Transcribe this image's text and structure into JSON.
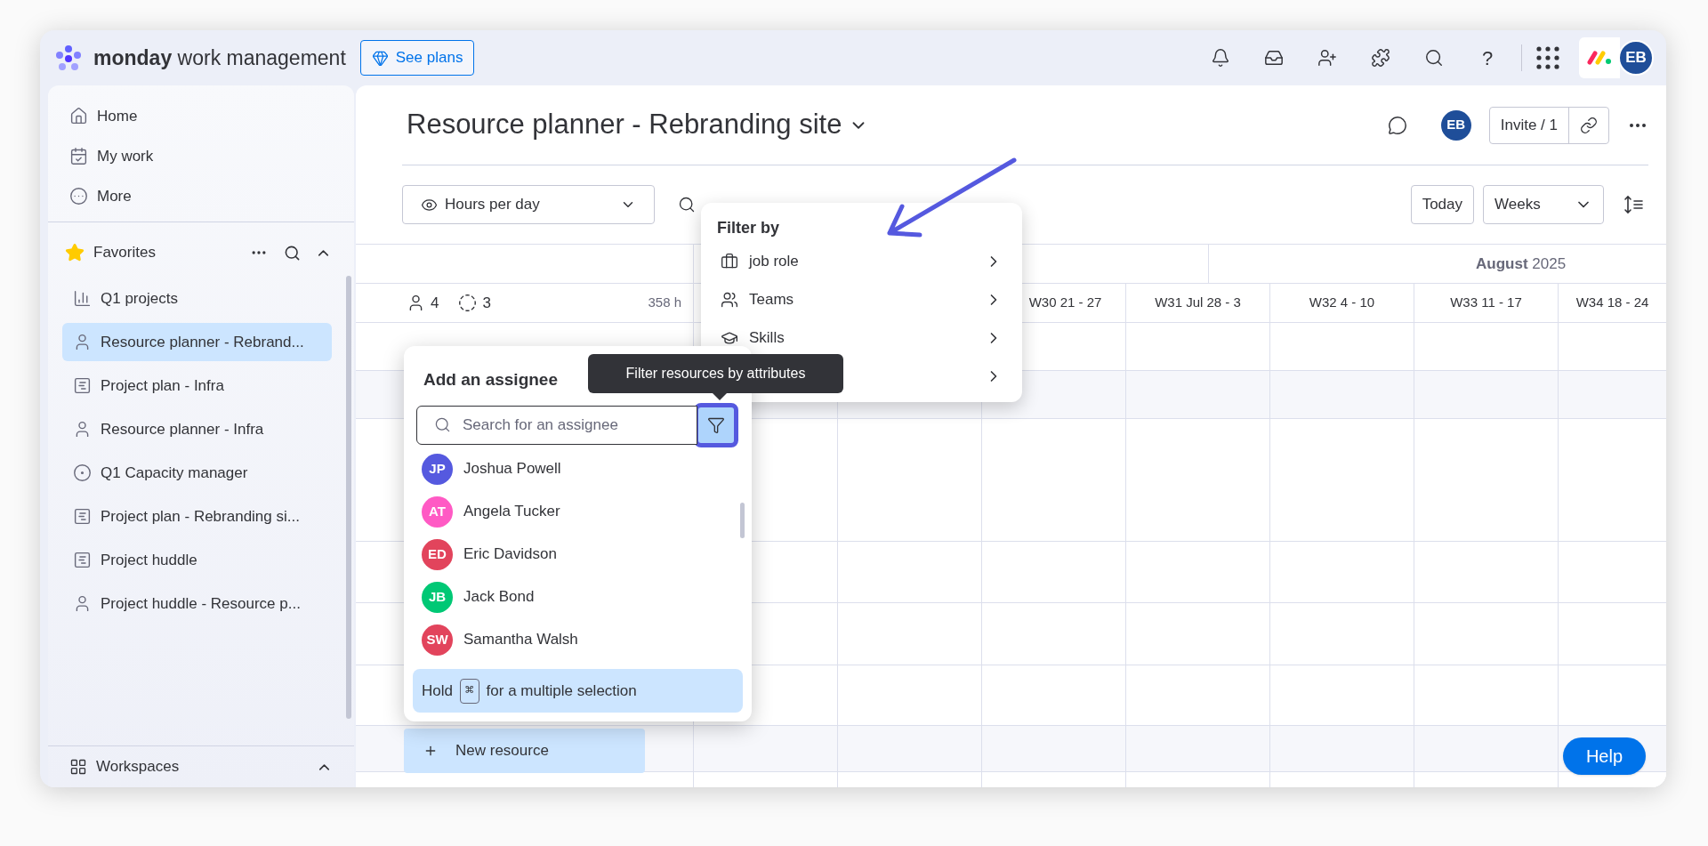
{
  "top_bar": {
    "brand_bold": "monday",
    "brand_rest": "work management",
    "plans_button": "See plans",
    "help_glyph": "?",
    "avatar": "EB"
  },
  "sidebar": {
    "nav": [
      {
        "label": "Home",
        "kind": "home"
      },
      {
        "label": "My work",
        "kind": "calendar"
      },
      {
        "label": "More",
        "kind": "more"
      }
    ],
    "favorites": {
      "title": "Favorites",
      "expanded": true,
      "items": [
        {
          "label": "Q1 projects",
          "kind": "chart",
          "selected": false
        },
        {
          "label": "Resource planner - Rebrand...",
          "kind": "person",
          "selected": true
        },
        {
          "label": "Project plan - Infra",
          "kind": "plan",
          "selected": false
        },
        {
          "label": "Resource planner - Infra",
          "kind": "person",
          "selected": false
        },
        {
          "label": "Q1 Capacity manager",
          "kind": "target",
          "selected": false
        },
        {
          "label": "Project plan - Rebranding si...",
          "kind": "plan",
          "selected": false
        },
        {
          "label": "Project huddle",
          "kind": "plan",
          "selected": false
        },
        {
          "label": "Project huddle - Resource p...",
          "kind": "person",
          "selected": false
        }
      ]
    },
    "workspaces": {
      "title": "Workspaces",
      "expanded": true
    }
  },
  "board": {
    "title": "Resource planner - Rebranding site",
    "avatar": "EB",
    "invite_button": "Invite / 1"
  },
  "toolbar": {
    "view_select": "Hours per day",
    "today_button": "Today",
    "scale_select": "Weeks"
  },
  "timeline": {
    "people_count": "4",
    "placeholder_count": "3",
    "total_hours": "358 h",
    "month": "**August** 2025",
    "weeks": [
      "W30 21 - 27",
      "W31 Jul 28 - 3",
      "W32 4 - 10",
      "W33 11 - 17",
      "W34 18 - 24"
    ],
    "new_resource_button": "New resource"
  },
  "filter_menu": {
    "title": "Filter by",
    "items": [
      {
        "label": "job role",
        "kind": "briefcase"
      },
      {
        "label": "Teams",
        "kind": "people"
      },
      {
        "label": "Skills",
        "kind": "graduation"
      },
      {
        "kind": "covered"
      }
    ]
  },
  "tooltip": "Filter resources by attributes",
  "assignee_picker": {
    "title": "Add an assignee",
    "placeholder": "Search for an assignee",
    "filter_active": true,
    "people": [
      {
        "initials": "JP",
        "name": "Joshua Powell",
        "color": "#5559df"
      },
      {
        "initials": "AT",
        "name": "Angela Tucker",
        "color": "#ff5ac4"
      },
      {
        "initials": "ED",
        "name": "Eric Davidson",
        "color": "#e2445c"
      },
      {
        "initials": "JB",
        "name": "Jack Bond",
        "color": "#00c875"
      },
      {
        "initials": "SW",
        "name": "Samantha Walsh",
        "color": "#e2445c"
      }
    ],
    "hint_before": "Hold",
    "key": "⌘",
    "hint_after": "for a multiple selection"
  },
  "help_button": "Help"
}
